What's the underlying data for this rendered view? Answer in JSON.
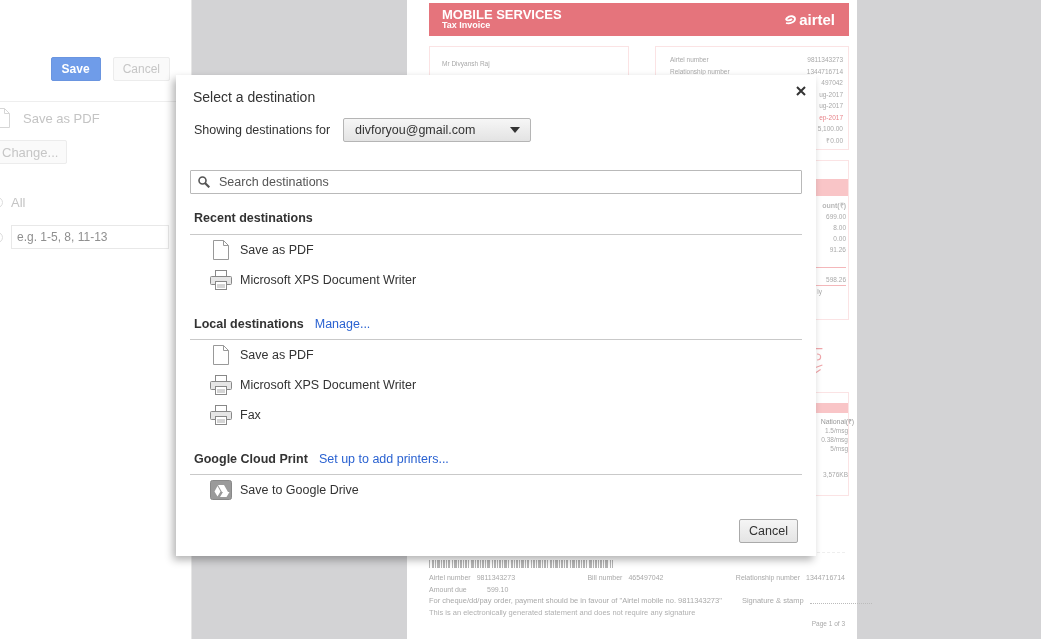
{
  "settings_panel": {
    "buttons": [
      {
        "label": "Save",
        "kind": "primary"
      },
      {
        "label": "Cancel",
        "kind": "secondary"
      }
    ],
    "destination": "Save as PDF",
    "change_button": "Change...",
    "pages": [
      {
        "kind": "label",
        "label": "All",
        "selected": false
      },
      {
        "kind": "input",
        "placeholder": "e.g. 1-5, 8, 11-13",
        "selected": false
      }
    ]
  },
  "preview": {
    "header": {
      "title": "MOBILE SERVICES",
      "subtitle": "Tax Invoice",
      "brand": "airtel"
    },
    "customer_name": "Mr Divyansh Raj",
    "account_rows": [
      {
        "label": "Airtel number",
        "value": "9811343273"
      },
      {
        "label": "Relationship number",
        "value": "1344716714"
      },
      {
        "value": "497042"
      },
      {
        "value": "ug-2017"
      },
      {
        "value": "ug-2017"
      },
      {
        "value": "ep-2017",
        "kind": "highlight"
      },
      {
        "value": "5,100.00"
      },
      {
        "value": "₹0.00"
      }
    ],
    "charges": {
      "heading": "ount(₹)",
      "values": [
        "699.00",
        "8.00",
        "0.00",
        "91.26"
      ],
      "total": "598.26",
      "note": "ly"
    },
    "rates": {
      "heading": "National(₹)",
      "values": [
        "1.5/msg",
        "0.38/msg",
        "5/msg"
      ],
      "usage": "3,576KB"
    },
    "slip": {
      "airtel_label": "Airtel number",
      "airtel_number": "9811343273",
      "bill_label": "Bill number",
      "bill_number": "465497042",
      "relationship_label": "Relationship number",
      "relationship_number": "1344716714",
      "amount_label": "Amount due",
      "amount": "599.10",
      "payment_note": "For cheque/dd/pay order, payment should be in favour of  \"Airtel mobile no. 9811343273\"",
      "signature_label": "Signature & stamp",
      "disclaimer": "This is an electronically generated statement and does not require any signature"
    },
    "page_number": "Page 1 of 3"
  },
  "dialog": {
    "title": "Select a destination",
    "account_label": "Showing destinations for",
    "account": "divforyou@gmail.com",
    "search_placeholder": "Search destinations",
    "sections": [
      {
        "title": "Recent destinations",
        "items": [
          {
            "label": "Save as PDF",
            "kind": "pdf"
          },
          {
            "label": "Microsoft XPS Document Writer",
            "kind": "printer"
          }
        ]
      },
      {
        "title": "Local destinations",
        "link": "Manage...",
        "items": [
          {
            "label": "Save as PDF",
            "kind": "pdf"
          },
          {
            "label": "Microsoft XPS Document Writer",
            "kind": "printer"
          },
          {
            "label": "Fax",
            "kind": "printer"
          }
        ]
      },
      {
        "title": "Google Cloud Print",
        "link": "Set up to add printers...",
        "items": [
          {
            "label": "Save to Google Drive",
            "kind": "drive"
          }
        ]
      }
    ],
    "cancel": "Cancel"
  }
}
